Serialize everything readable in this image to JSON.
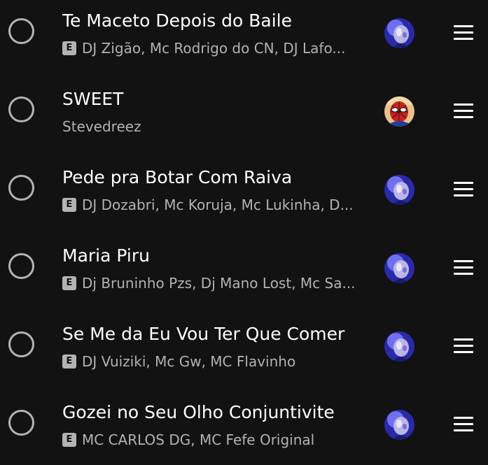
{
  "tracks": [
    {
      "title": "Te Maceto Depois do Baile",
      "explicit": true,
      "explicit_label": "E",
      "artists": "DJ Zigão, Mc Rodrigo do CN, DJ Lafo...",
      "avatar": "blue-portrait"
    },
    {
      "title": "SWEET",
      "explicit": false,
      "explicit_label": "",
      "artists": "Stevedreez",
      "avatar": "spiderman"
    },
    {
      "title": "Pede pra Botar Com Raiva",
      "explicit": true,
      "explicit_label": "E",
      "artists": "DJ Dozabri, Mc Koruja, Mc Lukinha, D...",
      "avatar": "blue-portrait"
    },
    {
      "title": "Maria Piru",
      "explicit": true,
      "explicit_label": "E",
      "artists": "Dj Bruninho Pzs, Dj Mano Lost, Mc Sa...",
      "avatar": "blue-portrait"
    },
    {
      "title": "Se Me da Eu Vou Ter Que Comer",
      "explicit": true,
      "explicit_label": "E",
      "artists": "DJ Vuiziki, Mc Gw, MC Flavinho",
      "avatar": "blue-portrait"
    },
    {
      "title": "Gozei no Seu Olho Conjuntivite",
      "explicit": true,
      "explicit_label": "E",
      "artists": "MC CARLOS DG, MC Fefe Original",
      "avatar": "blue-portrait"
    }
  ],
  "icons": {
    "select": "radio-circle-icon",
    "explicit": "explicit-badge-icon",
    "reorder": "drag-handle-icon"
  },
  "colors": {
    "background": "#121212",
    "title": "#ffffff",
    "secondary": "#b3b3b3"
  }
}
